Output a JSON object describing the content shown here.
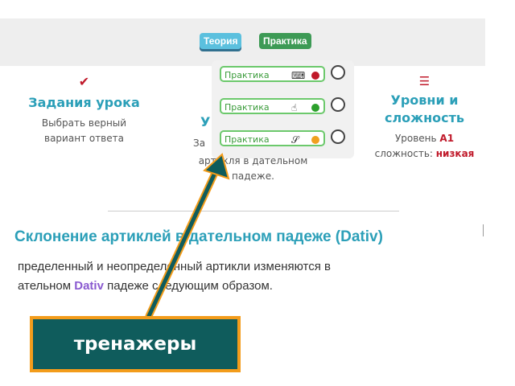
{
  "topbar": {
    "tabs": [
      {
        "label": "Теория"
      },
      {
        "label": "Практика"
      }
    ]
  },
  "columns": {
    "tasks": {
      "title": "Задания урока",
      "desc_line1": "Выбрать верный",
      "desc_line2": "вариант ответа"
    },
    "middle": {
      "title_partial": "У",
      "desc_prefix": "За",
      "desc_line2": "артикля в дательном",
      "desc_line3": "падеже."
    },
    "levels": {
      "title_line1": "Уровни и",
      "title_line2": "сложность",
      "level_prefix": "Уровень ",
      "level_value": "A1",
      "complexity_prefix": "сложность: ",
      "complexity_value": "низкая"
    }
  },
  "dropdown": {
    "items": [
      {
        "label": "Практика",
        "icon": "keyboard-icon",
        "symbol": "⌨",
        "dot_color": "#c0192a"
      },
      {
        "label": "Практика",
        "icon": "hand-pointer-icon",
        "symbol": "☝",
        "dot_color": "#2ca02c"
      },
      {
        "label": "Практика",
        "icon": "ear-icon",
        "symbol": "𝒮",
        "dot_color": "#f0a020"
      }
    ]
  },
  "lesson": {
    "heading": "Склонение артиклей в дательном падеже (Dativ)",
    "para_line1": "пределенный и неопределенный артикли изменяются в",
    "para_line2_prefix": "ательном ",
    "para_line2_highlight": "Dativ",
    "para_line2_suffix": " падеже следующим образом."
  },
  "callout": {
    "label": "тренажеры"
  },
  "colors": {
    "accent": "#2b9fb8",
    "callout_bg": "#0f5c5c",
    "callout_border": "#f39c1b",
    "practice_green": "#6cc96c"
  }
}
